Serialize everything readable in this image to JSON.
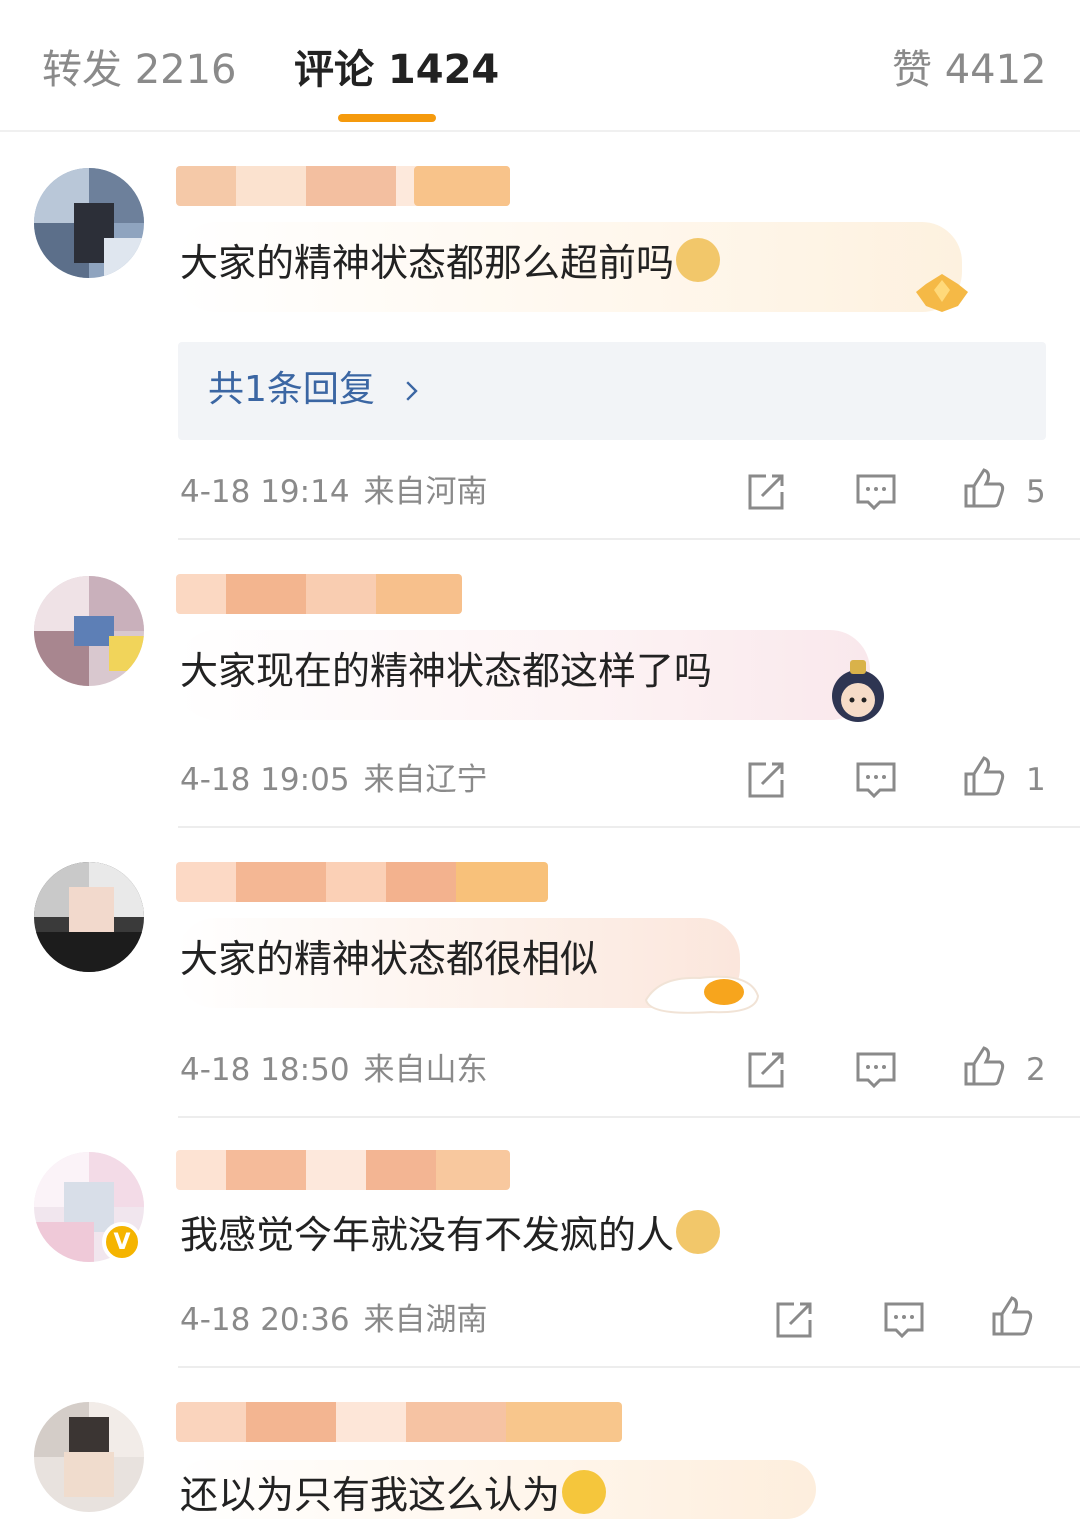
{
  "tabs": {
    "repost": "转发 2216",
    "comments": "评论 1424",
    "likes": "赞 4412"
  },
  "colors": {
    "accent": "#f59a0d",
    "reply_link": "#3b66a3",
    "meta_text": "#8a8a8a"
  },
  "comments": [
    {
      "text": "大家的精神状态都那么超前吗",
      "emoji": "doge-emoji",
      "reply_link": "共1条回复",
      "time": "4-18 19:14",
      "location": "来自河南",
      "likes": "5"
    },
    {
      "text": "大家现在的精神状态都这样了吗",
      "time": "4-18 19:05",
      "location": "来自辽宁",
      "likes": "1"
    },
    {
      "text": "大家的精神状态都很相似",
      "time": "4-18 18:50",
      "location": "来自山东",
      "likes": "2"
    },
    {
      "text": "我感觉今年就没有不发疯的人",
      "emoji": "doge-emoji",
      "time": "4-18 20:36",
      "location": "来自湖南",
      "likes": ""
    },
    {
      "text": "还以为只有我这么认为",
      "emoji": "laugh-cry-emoji"
    }
  ],
  "icons": {
    "share": "share-icon",
    "comment": "comment-icon",
    "like": "thumbs-up-icon",
    "reply_arrow": "chevron-right-icon"
  }
}
